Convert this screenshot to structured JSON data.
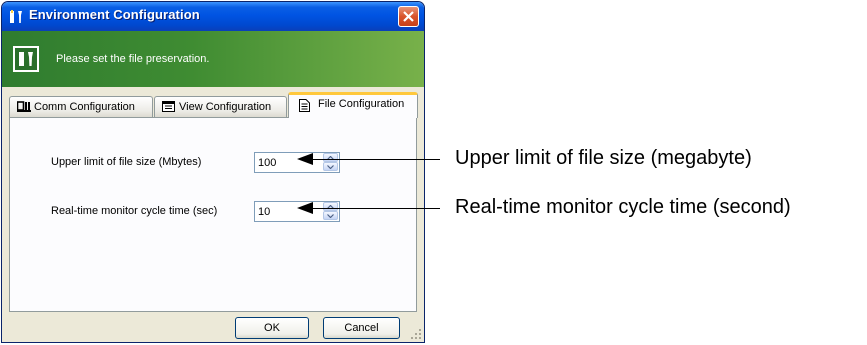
{
  "window": {
    "title": "Environment Configuration",
    "banner_text": "Please set the file preservation.",
    "close_icon": "close-icon",
    "app_icon": "tools-icon"
  },
  "tabs": [
    {
      "label": "Comm Configuration",
      "icon": "comm-icon",
      "active": false
    },
    {
      "label": "View Configuration",
      "icon": "view-icon",
      "active": false
    },
    {
      "label": "File Configuration",
      "icon": "document-icon",
      "active": true
    }
  ],
  "fields": {
    "file_size_label": "Upper limit of file size (Mbytes)",
    "file_size_value": "100",
    "cycle_time_label": "Real-time monitor cycle time (sec)",
    "cycle_time_value": "10"
  },
  "buttons": {
    "ok": "OK",
    "cancel": "Cancel"
  },
  "annotations": {
    "file_size": "Upper limit of file size (megabyte)",
    "cycle_time": "Real-time monitor cycle time (second)"
  },
  "colors": {
    "titlebar": "#0054e3",
    "banner": "#3f8c32",
    "active_tab_accent": "#ffc83c"
  }
}
